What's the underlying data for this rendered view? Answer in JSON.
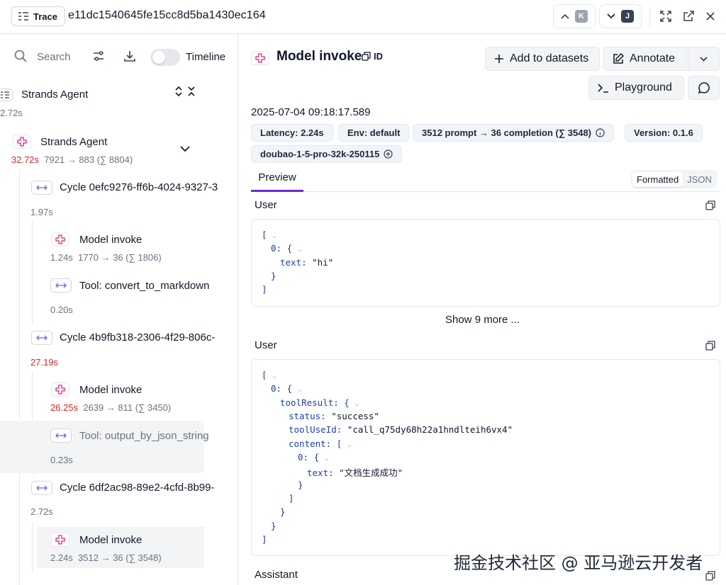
{
  "topbar": {
    "trace_label": "Trace",
    "trace_id": "e11dc1540645fe15cc8d5ba1430ec164",
    "prev_key": "K",
    "next_key": "J"
  },
  "left": {
    "search_placeholder": "Search",
    "timeline_label": "Timeline",
    "root": {
      "title": "Strands Agent",
      "time": "2.72s"
    },
    "agent": {
      "title": "Strands Agent",
      "time": "32.72s",
      "tokens": "7921 → 883 (∑ 8804)"
    },
    "cycle1": {
      "title": "Cycle 0efc9276-ff6b-4024-9327-3",
      "time": "1.97s"
    },
    "model1": {
      "title": "Model invoke",
      "time": "1.24s",
      "tokens": "1770 → 36 (∑ 1806)"
    },
    "tool1": {
      "title": "Tool: convert_to_markdown",
      "time": "0.20s"
    },
    "cycle2": {
      "title": "Cycle 4b9fb318-2306-4f29-806c-",
      "time": "27.19s"
    },
    "model2": {
      "title": "Model invoke",
      "time": "26.25s",
      "tokens": "2639 → 811 (∑ 3450)"
    },
    "tool2": {
      "title": "Tool: output_by_json_string",
      "time": "0.23s"
    },
    "cycle3": {
      "title": "Cycle 6df2ac98-89e2-4cfd-8b99-",
      "time": "2.72s"
    },
    "model3": {
      "title": "Model invoke",
      "time": "2.24s",
      "tokens": "3512 → 36 (∑ 3548)"
    }
  },
  "detail": {
    "title": "Model invoke",
    "id_label": "ID",
    "add_datasets": "Add to datasets",
    "annotate": "Annotate",
    "playground": "Playground",
    "timestamp": "2025-07-04 09:18:17.589",
    "pills": {
      "latency": "Latency: 2.24s",
      "env": "Env: default",
      "tokens": "3512 prompt → 36 completion (∑ 3548)",
      "version": "Version: 0.1.6",
      "model": "doubao-1-5-pro-32k-250115"
    },
    "tab_preview": "Preview",
    "fmt_formatted": "Formatted",
    "fmt_json": "JSON",
    "section1": "User",
    "section2": "User",
    "section3": "Assistant",
    "show_more": "Show 9 more ...",
    "block1": {
      "l1": "[",
      "l2_key": "0: {",
      "l3_key": "text: ",
      "l3_val": "\"hi\"",
      "l4": "}",
      "l5": "]"
    },
    "block2": {
      "l1": "[",
      "l2": "0: {",
      "l3": "toolResult: {",
      "l4_key": "status: ",
      "l4_val": "\"success\"",
      "l5_key": "toolUseId: ",
      "l5_val": "\"call_q75dy68h22a1hndlteih6vx4\"",
      "l6": "content: [",
      "l7": "0: {",
      "l8_key": "text: ",
      "l8_val": "\"文档生成成功\"",
      "l9": "}",
      "l10": "]",
      "l11": "}",
      "l12": "}",
      "l13": "]"
    }
  },
  "watermark": "掘金技术社区 @ 亚马逊云开发者"
}
